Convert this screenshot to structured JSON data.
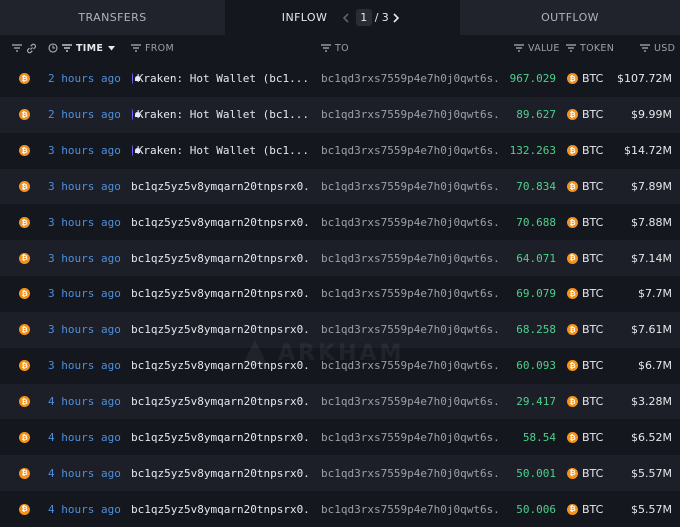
{
  "tabs": {
    "transfers": "TRANSFERS",
    "inflow": "INFLOW",
    "outflow": "OUTFLOW",
    "page_current": "1",
    "page_sep": "/",
    "page_total": "3"
  },
  "columns": {
    "time": "TIME",
    "from": "FROM",
    "to": "TO",
    "value": "VALUE",
    "token": "TOKEN",
    "usd": "USD"
  },
  "colors": {
    "background": "#15171e",
    "row_alt": "#1c1f27",
    "time_link": "#4c8fe0",
    "value_green": "#4cd28a",
    "btc_orange": "#f7931a",
    "kraken_purple": "#7b61ff"
  },
  "rows": [
    {
      "time": "2 hours ago",
      "from": "Kraken: Hot Wallet (bc1...",
      "from_icon": "kraken-icon",
      "to": "bc1qd3rxs7559p4e7h0j0qwt6s...",
      "value": "967.029",
      "token": "BTC",
      "usd": "$107.72M"
    },
    {
      "time": "2 hours ago",
      "from": "Kraken: Hot Wallet (bc1...",
      "from_icon": "kraken-icon",
      "to": "bc1qd3rxs7559p4e7h0j0qwt6s...",
      "value": "89.627",
      "token": "BTC",
      "usd": "$9.99M"
    },
    {
      "time": "3 hours ago",
      "from": "Kraken: Hot Wallet (bc1...",
      "from_icon": "kraken-icon",
      "to": "bc1qd3rxs7559p4e7h0j0qwt6s...",
      "value": "132.263",
      "token": "BTC",
      "usd": "$14.72M"
    },
    {
      "time": "3 hours ago",
      "from": "bc1qz5yz5v8ymqarn20tnpsrx0...",
      "from_icon": "",
      "to": "bc1qd3rxs7559p4e7h0j0qwt6s...",
      "value": "70.834",
      "token": "BTC",
      "usd": "$7.89M"
    },
    {
      "time": "3 hours ago",
      "from": "bc1qz5yz5v8ymqarn20tnpsrx0...",
      "from_icon": "",
      "to": "bc1qd3rxs7559p4e7h0j0qwt6s...",
      "value": "70.688",
      "token": "BTC",
      "usd": "$7.88M"
    },
    {
      "time": "3 hours ago",
      "from": "bc1qz5yz5v8ymqarn20tnpsrx0...",
      "from_icon": "",
      "to": "bc1qd3rxs7559p4e7h0j0qwt6s...",
      "value": "64.071",
      "token": "BTC",
      "usd": "$7.14M"
    },
    {
      "time": "3 hours ago",
      "from": "bc1qz5yz5v8ymqarn20tnpsrx0...",
      "from_icon": "",
      "to": "bc1qd3rxs7559p4e7h0j0qwt6s...",
      "value": "69.079",
      "token": "BTC",
      "usd": "$7.7M"
    },
    {
      "time": "3 hours ago",
      "from": "bc1qz5yz5v8ymqarn20tnpsrx0...",
      "from_icon": "",
      "to": "bc1qd3rxs7559p4e7h0j0qwt6s...",
      "value": "68.258",
      "token": "BTC",
      "usd": "$7.61M"
    },
    {
      "time": "3 hours ago",
      "from": "bc1qz5yz5v8ymqarn20tnpsrx0...",
      "from_icon": "",
      "to": "bc1qd3rxs7559p4e7h0j0qwt6s...",
      "value": "60.093",
      "token": "BTC",
      "usd": "$6.7M"
    },
    {
      "time": "4 hours ago",
      "from": "bc1qz5yz5v8ymqarn20tnpsrx0...",
      "from_icon": "",
      "to": "bc1qd3rxs7559p4e7h0j0qwt6s...",
      "value": "29.417",
      "token": "BTC",
      "usd": "$3.28M"
    },
    {
      "time": "4 hours ago",
      "from": "bc1qz5yz5v8ymqarn20tnpsrx0...",
      "from_icon": "",
      "to": "bc1qd3rxs7559p4e7h0j0qwt6s...",
      "value": "58.54",
      "token": "BTC",
      "usd": "$6.52M"
    },
    {
      "time": "4 hours ago",
      "from": "bc1qz5yz5v8ymqarn20tnpsrx0...",
      "from_icon": "",
      "to": "bc1qd3rxs7559p4e7h0j0qwt6s...",
      "value": "50.001",
      "token": "BTC",
      "usd": "$5.57M"
    },
    {
      "time": "4 hours ago",
      "from": "bc1qz5yz5v8ymqarn20tnpsrx0...",
      "from_icon": "",
      "to": "bc1qd3rxs7559p4e7h0j0qwt6s...",
      "value": "50.006",
      "token": "BTC",
      "usd": "$5.57M"
    }
  ],
  "watermark": "ARKHAM"
}
